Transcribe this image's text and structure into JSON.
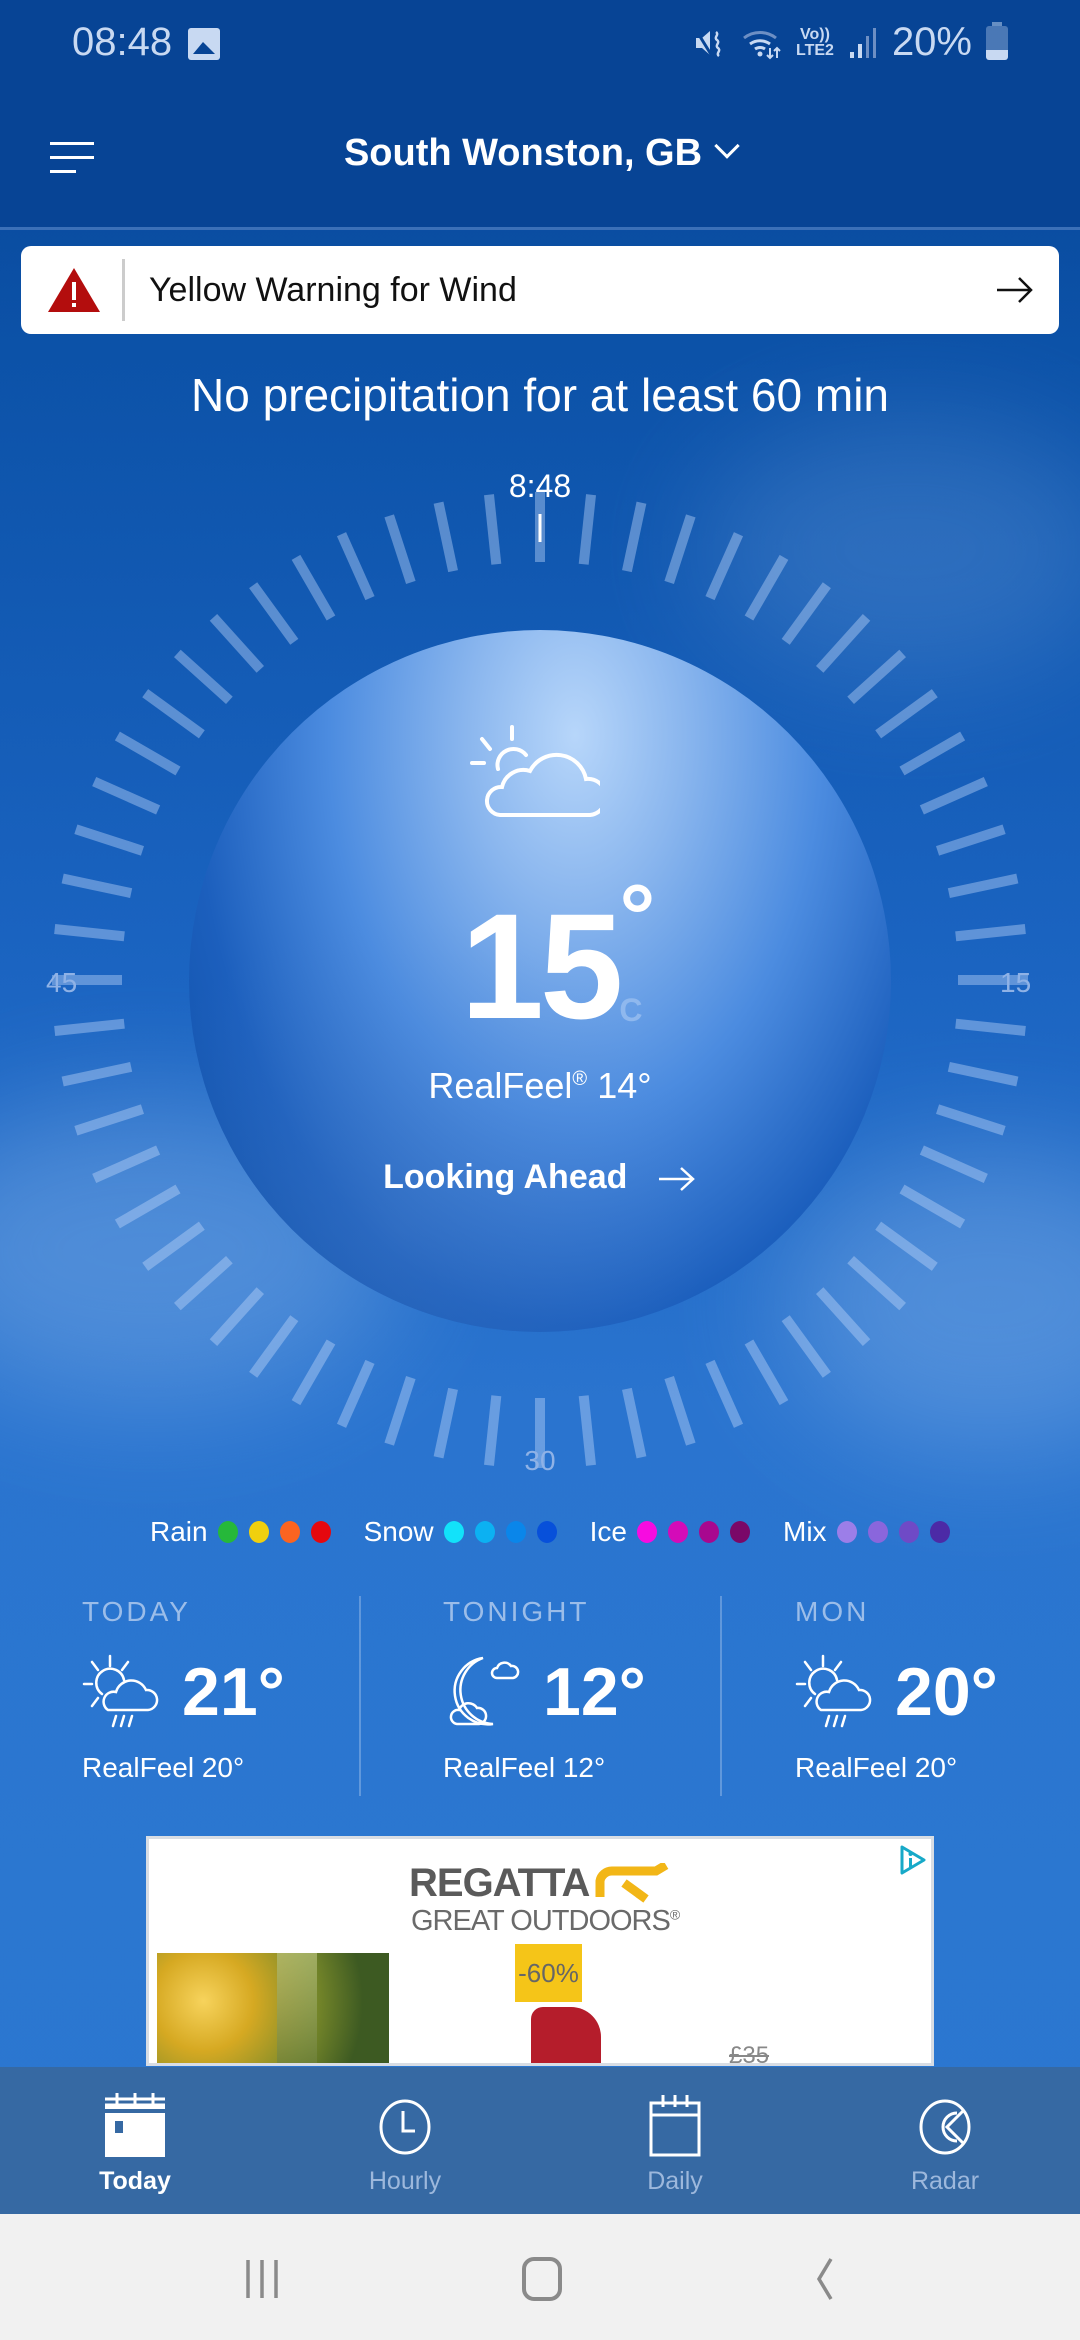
{
  "status_bar": {
    "time": "08:48",
    "network_label_top": "Vo))",
    "network_label_bottom": "LTE2",
    "battery_percent": "20%",
    "battery_level": 0.2,
    "icons": [
      "gallery-icon",
      "mute-vibrate-icon",
      "wifi-icon",
      "signal-icon",
      "battery-charging-icon"
    ]
  },
  "app_bar": {
    "location": "South Wonston, GB",
    "menu_icon": "hamburger-menu-icon",
    "dropdown_icon": "chevron-down-icon"
  },
  "alert": {
    "text": "Yellow Warning for Wind",
    "icon": "warning-triangle-icon",
    "arrow_icon": "arrow-right-icon",
    "color": "#b30d0d"
  },
  "nowcast": "No precipitation for at least 60 min",
  "dial": {
    "current_time": "8:48",
    "label_right": "15",
    "label_bottom": "30",
    "label_left": "45",
    "minutes_total": 60
  },
  "current": {
    "condition_icon": "partly-cloudy-icon",
    "temperature": "15",
    "degree_symbol": "°",
    "unit": "C",
    "realfeel_label": "RealFeel",
    "realfeel_reg": "®",
    "realfeel_value": "14°",
    "looking_ahead": "Looking Ahead"
  },
  "legend": [
    {
      "label": "Rain",
      "colors": [
        "#26b83a",
        "#f0d00e",
        "#fb6420",
        "#e5080e"
      ]
    },
    {
      "label": "Snow",
      "colors": [
        "#12e2fa",
        "#0cb1f2",
        "#0a86ea",
        "#0750da"
      ]
    },
    {
      "label": "Ice",
      "colors": [
        "#f70ce0",
        "#d40bb8",
        "#a8088f",
        "#7a0868"
      ]
    },
    {
      "label": "Mix",
      "colors": [
        "#9c7ee8",
        "#8a66dc",
        "#6f4ac6",
        "#4c2aa6"
      ]
    }
  ],
  "forecast": [
    {
      "title": "TODAY",
      "icon": "partly-sunny-showers-icon",
      "temp": "21°",
      "realfeel": "RealFeel 20°"
    },
    {
      "title": "TONIGHT",
      "icon": "moon-cloud-icon",
      "temp": "12°",
      "realfeel": "RealFeel 12°"
    },
    {
      "title": "MON",
      "icon": "partly-sunny-showers-icon",
      "temp": "20°",
      "realfeel": "RealFeel 20°"
    }
  ],
  "ad": {
    "brand_line1": "REGATTA",
    "brand_line2": "GREAT OUTDOORS",
    "brand_tm": "®",
    "discount": "-60%",
    "old_price": "£35",
    "info_icon": "ad-choices-icon"
  },
  "tabs": [
    {
      "label": "Today",
      "icon": "calendar-today-icon",
      "active": true
    },
    {
      "label": "Hourly",
      "icon": "clock-icon",
      "active": false
    },
    {
      "label": "Daily",
      "icon": "calendar-icon",
      "active": false
    },
    {
      "label": "Radar",
      "icon": "radar-icon",
      "active": false
    }
  ],
  "system_nav": [
    "recents-button",
    "home-button",
    "back-button"
  ]
}
